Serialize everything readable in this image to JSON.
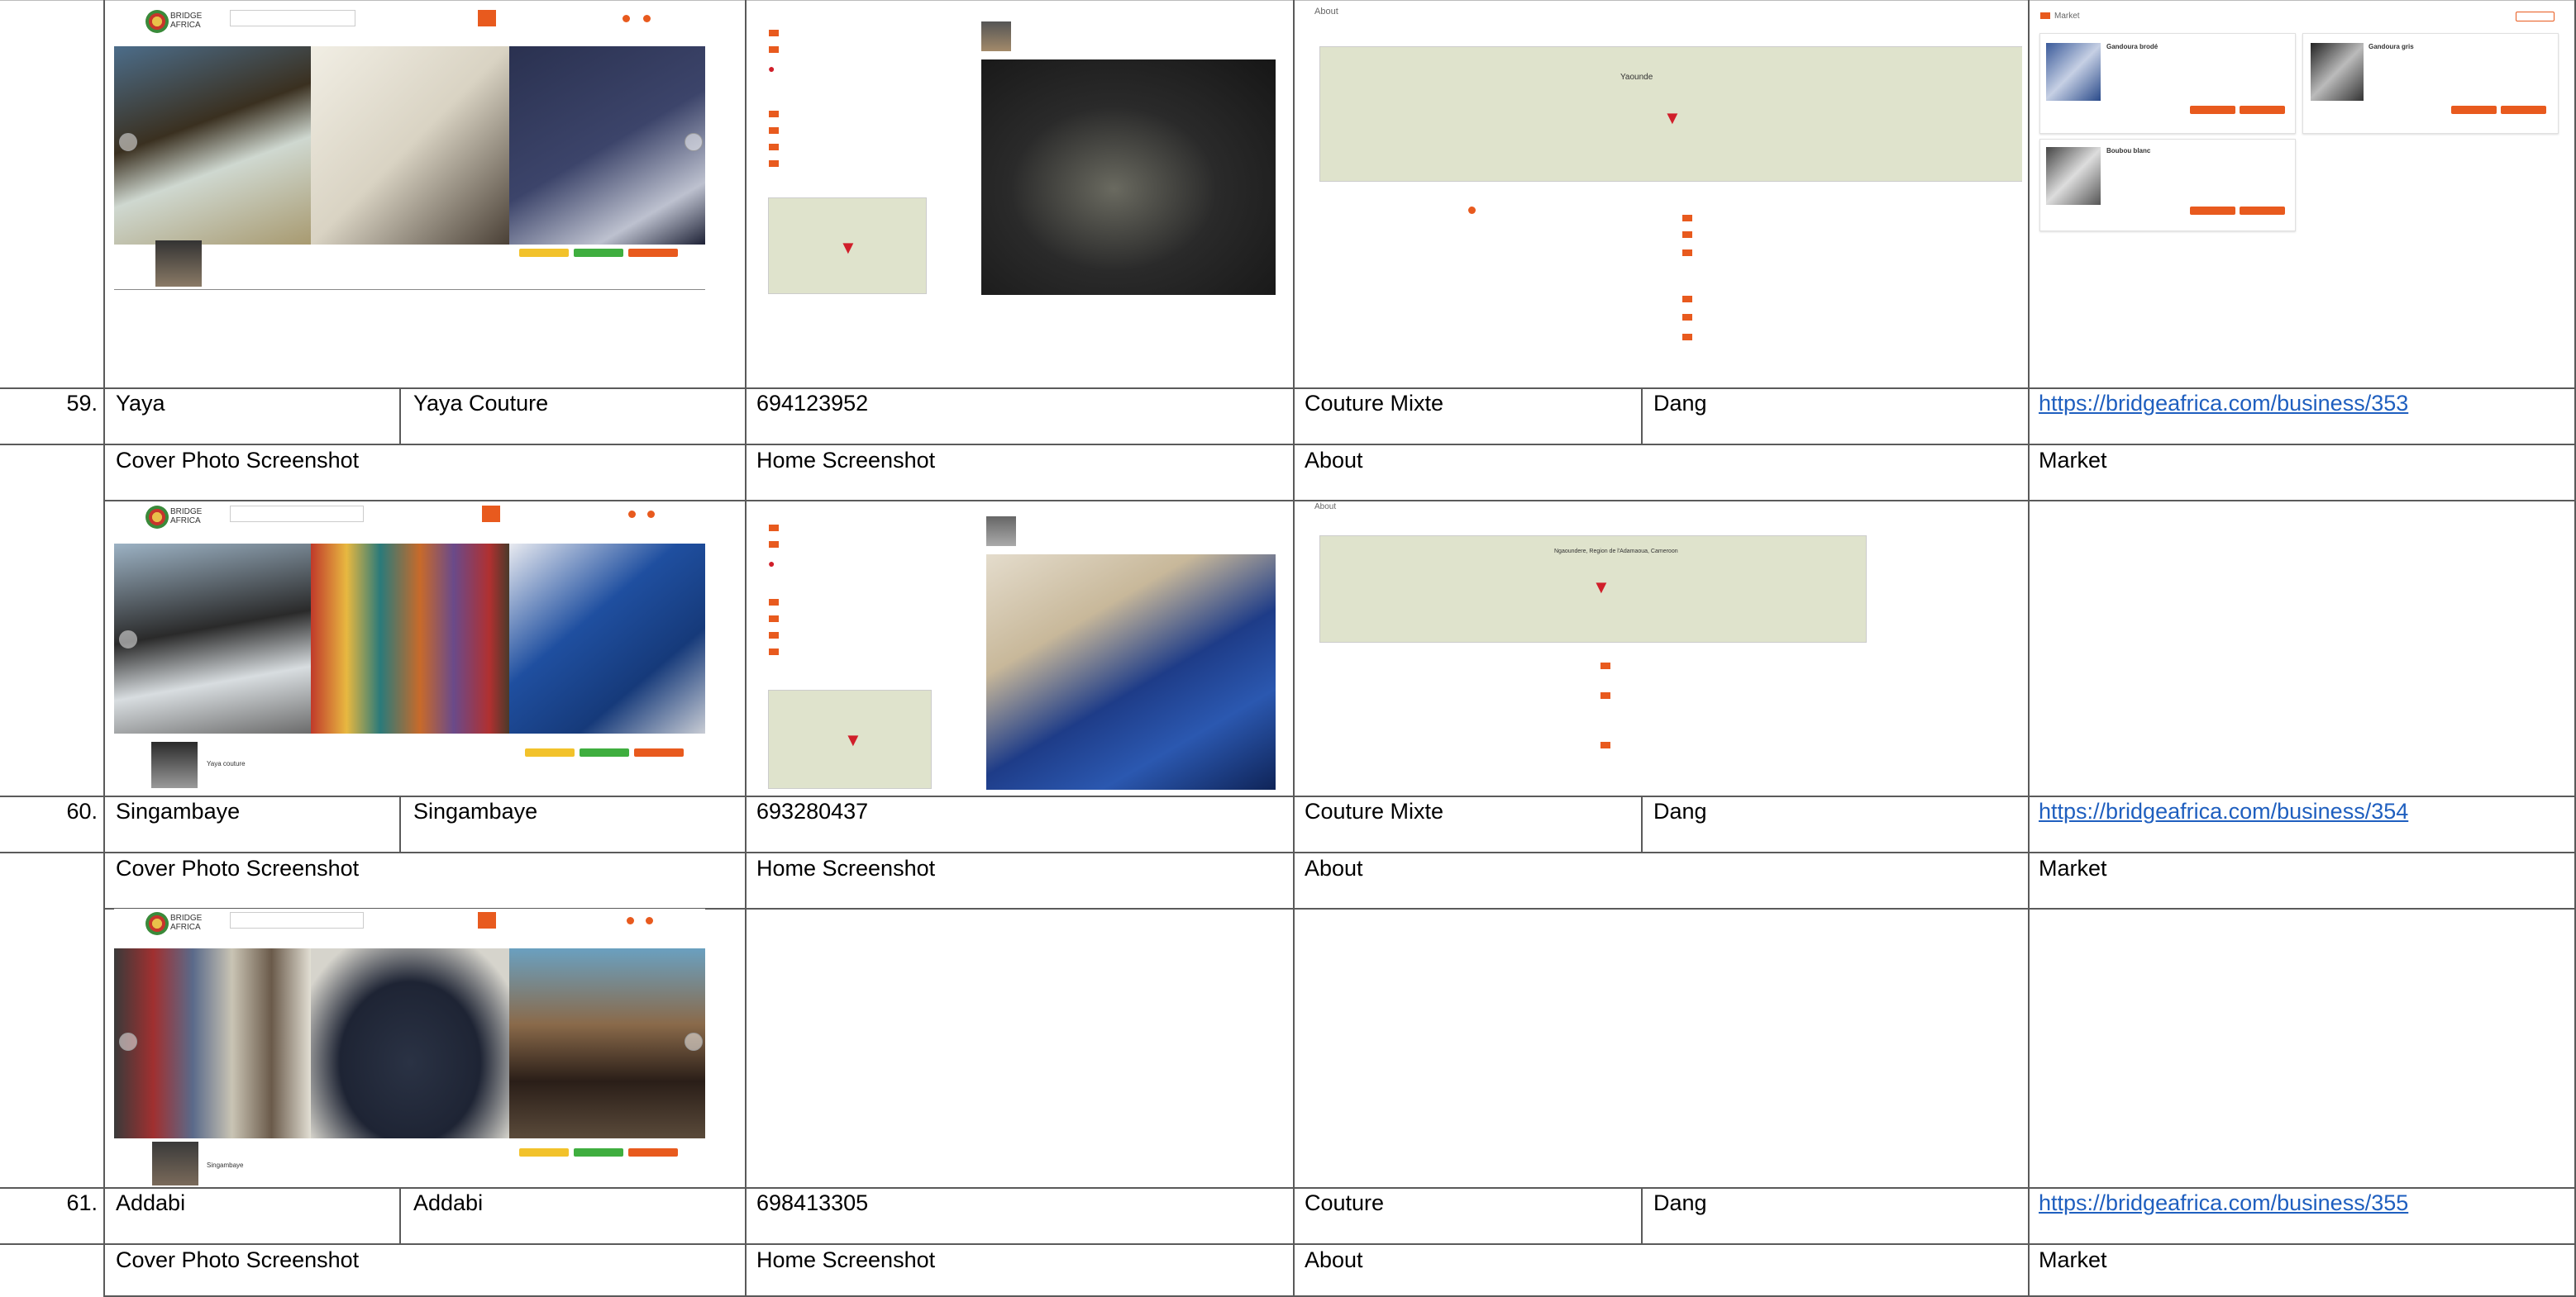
{
  "headers": {
    "cover": "Cover Photo Screenshot",
    "home": "Home Screenshot",
    "about": "About",
    "market": "Market"
  },
  "rows": [
    {
      "num": "59.",
      "name": "Yaya",
      "business": "Yaya Couture",
      "phone": "694123952",
      "category": "Couture Mixte",
      "locality": "Dang",
      "url": "https://bridgeafrica.com/business/353"
    },
    {
      "num": "60.",
      "name": "Singambaye",
      "business": "Singambaye",
      "phone": "693280437",
      "category": "Couture Mixte",
      "locality": "Dang",
      "url": "https://bridgeafrica.com/business/354"
    },
    {
      "num": "61.",
      "name": "Addabi",
      "business": "Addabi",
      "phone": "698413305",
      "category": "Couture",
      "locality": "Dang",
      "url": "https://bridgeafrica.com/business/355"
    }
  ],
  "shots": {
    "logo_text": "BRIDGE\nAFRICA",
    "about_label": "About",
    "market_label": "Market",
    "market_items": [
      "Gandoura brodé",
      "Gandoura gris",
      "Boubou blanc"
    ],
    "about_labels": [
      "Yaounde",
      "Ngaoundere, Region de l'Adamaoua, Cameroon"
    ],
    "yaya_label": "Yaya couture",
    "singambaye_label": "Singambaye"
  },
  "colors": {
    "link": "#1f5fbf",
    "grid": "#5a5a5a",
    "brand_orange": "#e85a1e",
    "btn_yellow": "#f2c22b",
    "btn_green": "#3fae3f"
  }
}
